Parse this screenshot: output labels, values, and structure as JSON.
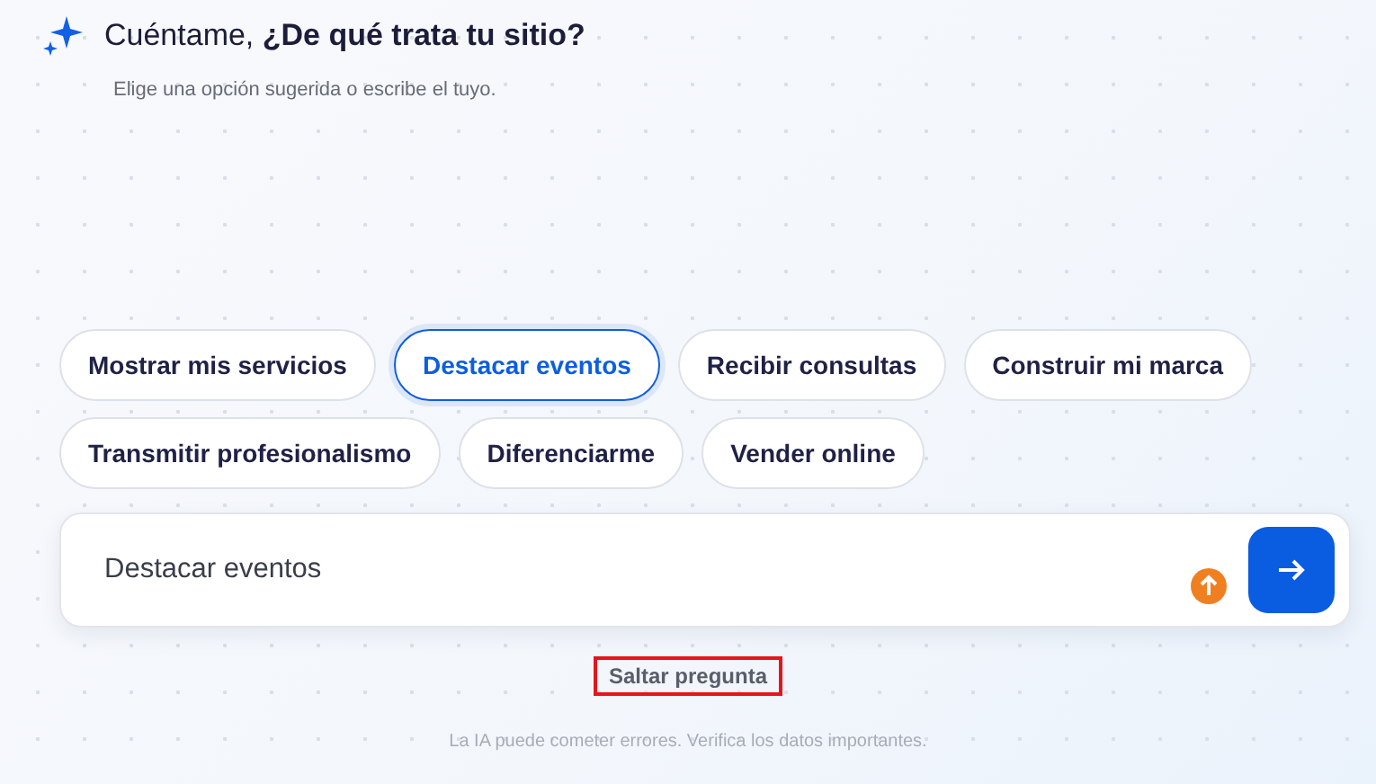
{
  "header": {
    "title": "Cuéntame, **¿De qué trata tu sitio?**",
    "subtitle": "Elige una opción sugerida o escribe el tuyo."
  },
  "options": [
    {
      "label": "Mostrar mis servicios",
      "selected": false
    },
    {
      "label": "Destacar eventos",
      "selected": true
    },
    {
      "label": "Recibir consultas",
      "selected": false
    },
    {
      "label": "Construir mi marca",
      "selected": false
    },
    {
      "label": "Transmitir profesionalismo",
      "selected": false
    },
    {
      "label": "Diferenciarme",
      "selected": false
    },
    {
      "label": "Vender online",
      "selected": false
    }
  ],
  "input": {
    "value": "Destacar eventos"
  },
  "skip_link": {
    "label": "Saltar pregunta",
    "highlighted": true
  },
  "footer": "La IA puede cometer errores. Verifica los datos importantes."
}
